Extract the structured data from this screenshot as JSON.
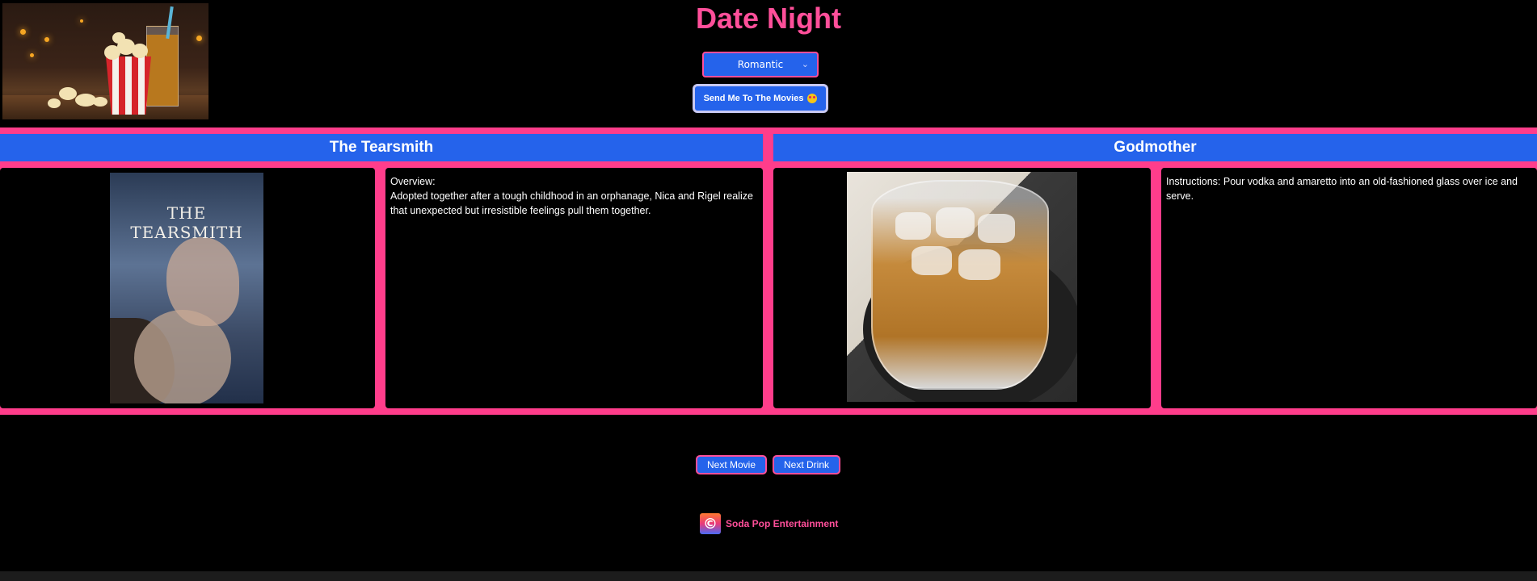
{
  "header": {
    "title": "Date Night",
    "hero_image": "popcorn-and-soda-image",
    "mood_select": {
      "value": "Romantic",
      "icon": "chevron-down-icon"
    },
    "send_button": {
      "label": "Send Me To The Movies",
      "icon": "heart-eyes-emoji"
    }
  },
  "movie": {
    "title": "The Tearsmith",
    "poster_text": "THE TEARSMITH",
    "overview_label": "Overview:",
    "overview": "Adopted together after a tough childhood in an orphanage, Nica and Rigel realize that unexpected but irresistible feelings pull them together."
  },
  "drink": {
    "title": "Godmother",
    "image": "cocktail-glass-image",
    "instructions": "Instructions: Pour vodka and amaretto into an old-fashioned glass over ice and serve."
  },
  "actions": {
    "next_movie": "Next Movie",
    "next_drink": "Next Drink"
  },
  "footer": {
    "logo_glyph": "©",
    "brand": "Soda Pop Entertainment"
  },
  "colors": {
    "accent_pink": "#ff4f9a",
    "frame_pink": "#ff3d8b",
    "button_blue": "#2563eb",
    "background": "#000000"
  }
}
